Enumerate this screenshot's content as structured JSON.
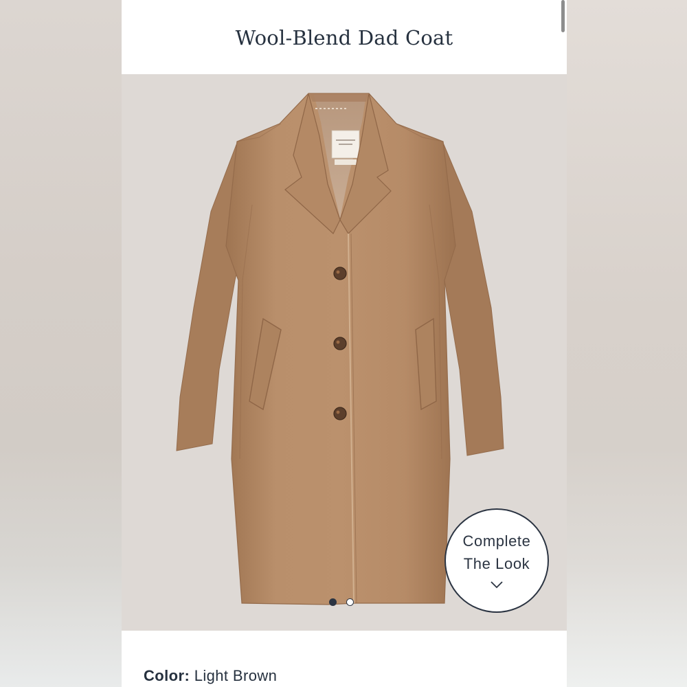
{
  "product": {
    "title": "Wool-Blend Dad Coat",
    "image_alt": "Light brown wool-blend coat",
    "label_brand": "Abercrombie & Fitch"
  },
  "overlay": {
    "complete_look_line1": "Complete",
    "complete_look_line2": "The Look",
    "chevron_icon": "chevron-down-icon"
  },
  "carousel": {
    "total": 2,
    "active_index": 1
  },
  "details": {
    "color_label": "Color:",
    "color_value": "Light Brown"
  },
  "colors": {
    "text": "#26313f",
    "coat": "#b58b67",
    "background": "#ded9d5",
    "accent_dark": "#2b3442"
  }
}
